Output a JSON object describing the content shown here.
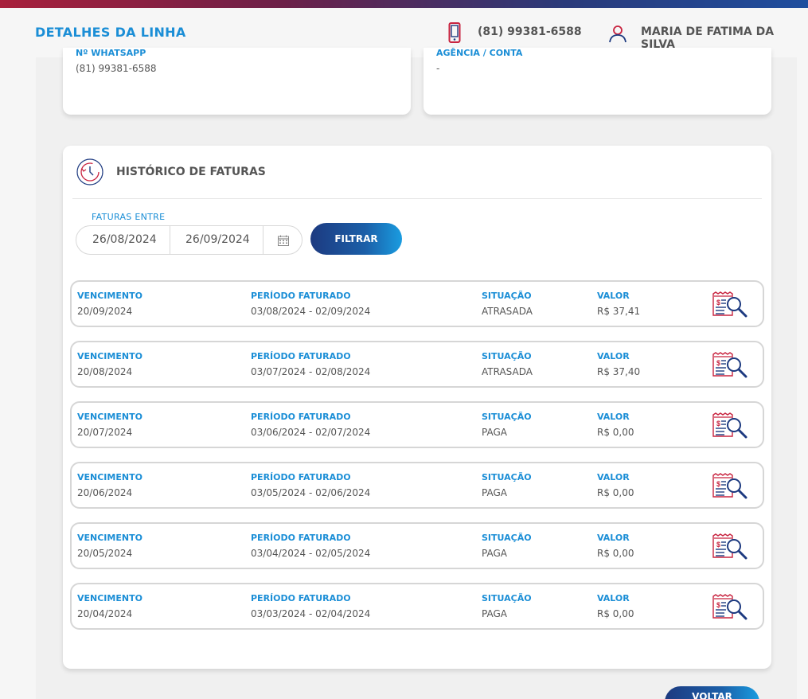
{
  "header": {
    "title": "DETALHES DA LINHA",
    "phone": "(81) 99381-6588",
    "user_name": "MARIA DE FATIMA DA SILVA"
  },
  "whatsapp": {
    "label": "Nº WHATSAPP",
    "value": "(81) 99381-6588"
  },
  "agencia": {
    "label": "AGÊNCIA / CONTA",
    "value": "-"
  },
  "history": {
    "title": "HISTÓRICO DE FATURAS",
    "filter_label": "FATURAS ENTRE",
    "date_from": "26/08/2024",
    "date_to": "26/09/2024",
    "filter_button": "FILTRAR"
  },
  "columns": {
    "due": "VENCIMENTO",
    "period": "PERÍODO FATURADO",
    "status": "SITUAÇÃO",
    "value": "VALOR"
  },
  "invoices": [
    {
      "due": "20/09/2024",
      "period": "03/08/2024 - 02/09/2024",
      "status": "ATRASADA",
      "value": "R$ 37,41"
    },
    {
      "due": "20/08/2024",
      "period": "03/07/2024 - 02/08/2024",
      "status": "ATRASADA",
      "value": "R$ 37,40"
    },
    {
      "due": "20/07/2024",
      "period": "03/06/2024 - 02/07/2024",
      "status": "PAGA",
      "value": "R$ 0,00"
    },
    {
      "due": "20/06/2024",
      "period": "03/05/2024 - 02/06/2024",
      "status": "PAGA",
      "value": "R$ 0,00"
    },
    {
      "due": "20/05/2024",
      "period": "03/04/2024 - 02/05/2024",
      "status": "PAGA",
      "value": "R$ 0,00"
    },
    {
      "due": "20/04/2024",
      "period": "03/03/2024 - 02/04/2024",
      "status": "PAGA",
      "value": "R$ 0,00"
    }
  ],
  "back_button": "VOLTAR",
  "colors": {
    "accent": "#1b8ed6",
    "brand_red": "#c8233f",
    "brand_navy": "#1d3a80"
  },
  "icons": {
    "phone": "phone-icon",
    "user": "user-icon",
    "history": "clock-history-icon",
    "calendar": "calendar-icon",
    "invoice": "invoice-search-icon"
  }
}
